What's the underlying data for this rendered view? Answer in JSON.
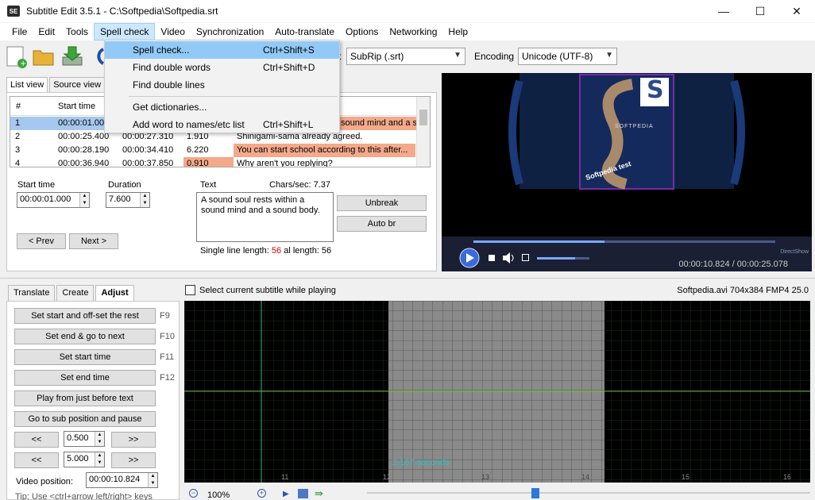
{
  "window": {
    "app_icon": "SE",
    "title": "Subtitle Edit 3.5.1 - C:\\Softpedia\\Softpedia.srt",
    "minimize": "—",
    "maximize": "☐",
    "close": "✕"
  },
  "menu": [
    "File",
    "Edit",
    "Tools",
    "Spell check",
    "Video",
    "Synchronization",
    "Auto-translate",
    "Options",
    "Networking",
    "Help"
  ],
  "spell_menu": [
    {
      "label": "Spell check...",
      "shortcut": "Ctrl+Shift+S"
    },
    {
      "label": "Find double words",
      "shortcut": "Ctrl+Shift+D"
    },
    {
      "label": "Find double lines",
      "shortcut": ""
    },
    {
      "label": "Get dictionaries...",
      "shortcut": ""
    },
    {
      "label": "Add word to names/etc list",
      "shortcut": "Ctrl+Shift+L"
    }
  ],
  "toolbar": {
    "format_label_partial": "t",
    "format_value": "SubRip (.srt)",
    "encoding_label": "Encoding",
    "encoding_value": "Unicode (UTF-8)"
  },
  "tabs_top": [
    "List view",
    "Source view"
  ],
  "grid": {
    "headers": {
      "num": "#",
      "start": "Start time"
    },
    "rows": [
      {
        "num": "1",
        "start": "00:00:01.00",
        "end": "",
        "dur": "",
        "text": "sound mind and a s"
      },
      {
        "num": "2",
        "start": "00:00:25.400",
        "end": "00:00:27.310",
        "dur": "1.910",
        "text": "Shinigami-sama already agreed."
      },
      {
        "num": "3",
        "start": "00:00:28.190",
        "end": "00:00:34.410",
        "dur": "6.220",
        "text": "You can start school according to this after..."
      },
      {
        "num": "4",
        "start": "00:00:36.940",
        "end": "00:00:37.850",
        "dur": "0.910",
        "text": "Why aren't you replying?"
      }
    ]
  },
  "editor": {
    "start_label": "Start time",
    "start_value": "00:00:01.000",
    "duration_label": "Duration",
    "duration_value": "7.600",
    "text_label": "Text",
    "chars_sec": "Chars/sec: 7.37",
    "text_value": "A sound soul rests within a sound mind and a sound body.",
    "unbreak": "Unbreak",
    "auto_br": "Auto br",
    "prev": "< Prev",
    "next": "Next >",
    "single_line_label": "Single line length:",
    "single_line_value": "56",
    "total_label": "al length: 56"
  },
  "video": {
    "cover_letter": "S",
    "cover_brand": "SOFTPEDIA",
    "cover_caption": "Softpedia test",
    "time": "00:00:10.824 / 00:00:25.078",
    "overlay": "DirectShow"
  },
  "bottom": {
    "tabs": [
      "Translate",
      "Create",
      "Adjust"
    ],
    "select_current": "Select current subtitle while playing",
    "file_info": "Softpedia.avi 704x384 FMP4 25.0",
    "buttons": [
      {
        "label": "Set start and off-set the rest",
        "key": "F9"
      },
      {
        "label": "Set end & go to next",
        "key": "F10"
      },
      {
        "label": "Set start time",
        "key": "F11"
      },
      {
        "label": "Set end time",
        "key": "F12"
      },
      {
        "label": "Play from just before text",
        "key": ""
      },
      {
        "label": "Go to sub position and pause",
        "key": ""
      }
    ],
    "back": "<<",
    "forward": ">>",
    "step1": "0.500",
    "step2": "5.000",
    "video_pos_label": "Video position:",
    "video_pos_value": "00:00:10.824",
    "tip": "Tip: Use <ctrl+arrow left/right> keys",
    "zoom": "100%"
  },
  "waveform": {
    "seconds_label": "2.167 seconds",
    "ticks": [
      "11",
      "12",
      "13",
      "14",
      "15",
      "16"
    ]
  }
}
